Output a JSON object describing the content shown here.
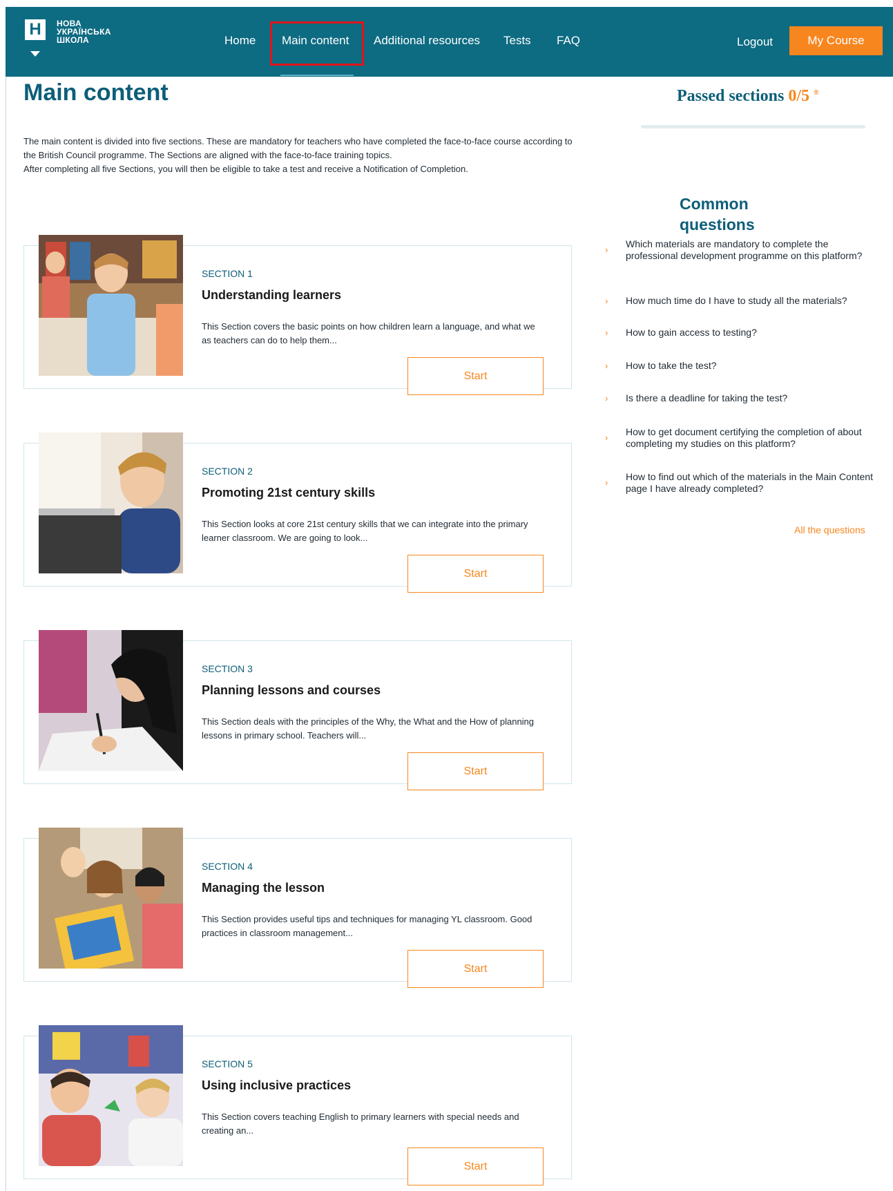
{
  "logo": {
    "mark": "Н",
    "line1": "НОВА",
    "line2": "УКРАЇНСЬКА",
    "line3": "ШКОЛА"
  },
  "nav": {
    "home": "Home",
    "main_content": "Main content",
    "additional": "Additional resources",
    "tests": "Tests",
    "faq": "FAQ",
    "logout": "Logout",
    "my_course": "My Course"
  },
  "main": {
    "title": "Main content",
    "intro_1": "The main content is divided into five sections. These are mandatory for teachers who have completed the face-to-face course according to the British Council programme. The Sections are aligned with the face-to-face training topics.",
    "intro_2": "After completing all five Sections, you will then be eligible to take a test and receive a Notification of Completion.",
    "sections": [
      {
        "label": "SECTION 1",
        "title": "Understanding learners",
        "desc": "This Section covers the basic points on how children learn a language, and what we as teachers can do to help them...",
        "button": "Start"
      },
      {
        "label": "SECTION 2",
        "title": "Promoting 21st century skills",
        "desc": "This Section looks at core 21st century skills that we can integrate into the primary learner classroom. We are going to look...",
        "button": "Start"
      },
      {
        "label": "SECTION 3",
        "title": "Planning lessons and courses",
        "desc": "This Section deals with the principles of the Why, the What and the How of planning lessons in primary school. Teachers will...",
        "button": "Start"
      },
      {
        "label": "SECTION 4",
        "title": "Managing the lesson",
        "desc": "This Section provides useful tips and techniques for managing YL classroom. Good practices in classroom management...",
        "button": "Start"
      },
      {
        "label": "SECTION 5",
        "title": "Using inclusive practices",
        "desc": "This Section covers teaching English to primary learners with special needs and creating an...",
        "button": "Start"
      }
    ]
  },
  "sidebar": {
    "passed_label": "Passed sections",
    "passed_count": "0/5",
    "info_mark": "®",
    "progress_fraction": 0,
    "common_questions_title": "Common questions",
    "questions": [
      "Which materials are mandatory to complete the professional development programme on this platform?",
      "How much time do I have to study all the materials?",
      "How to gain access to testing?",
      "How to take the test?",
      "Is there a deadline for taking the test?",
      "How to get document certifying the completion of about completing my studies on this platform?",
      "How to find out which of the materials in the Main Content page I have already completed?"
    ],
    "chevron": "›",
    "all_questions": "All the questions"
  },
  "colors": {
    "header": "#0d6b82",
    "accent": "#f7861e",
    "title": "#0d5e78",
    "highlight": "#e0141a"
  }
}
